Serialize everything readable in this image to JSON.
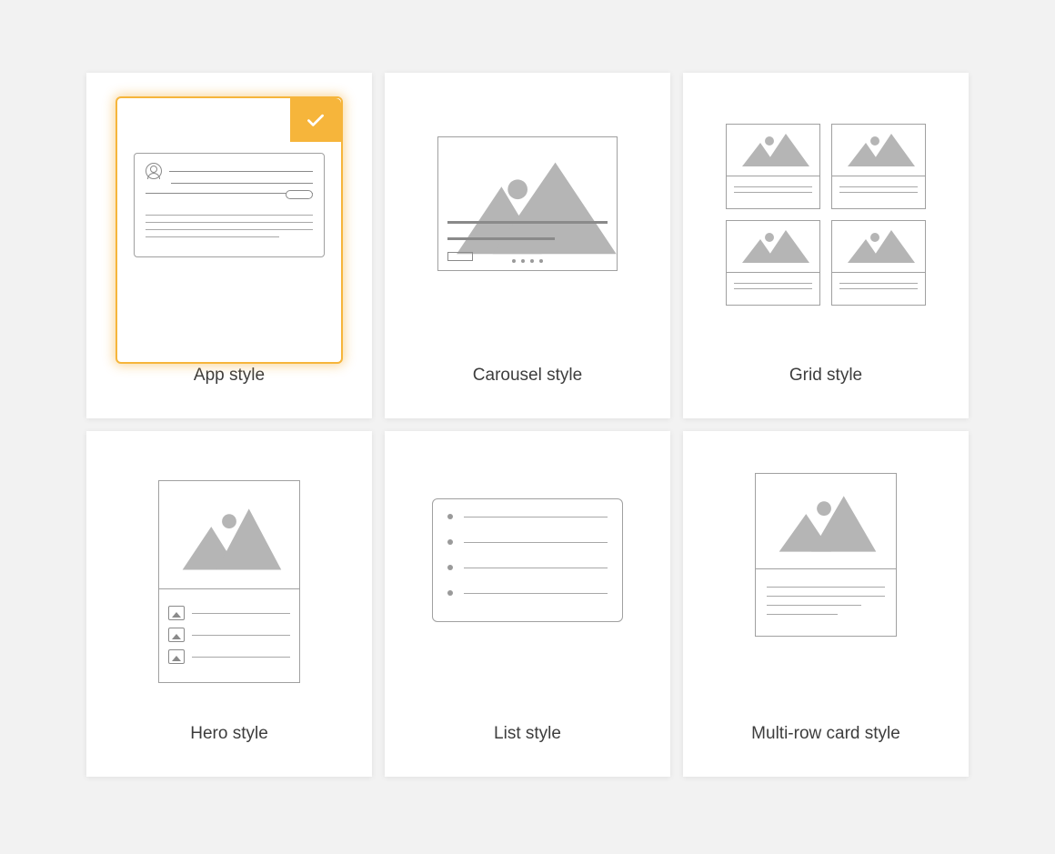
{
  "accent_color": "#F6B53B",
  "styles": {
    "app": {
      "label": "App style",
      "selected": true
    },
    "carousel": {
      "label": "Carousel style",
      "selected": false
    },
    "grid": {
      "label": "Grid style",
      "selected": false
    },
    "hero": {
      "label": "Hero style",
      "selected": false
    },
    "list": {
      "label": "List style",
      "selected": false
    },
    "multirow": {
      "label": "Multi-row card style",
      "selected": false
    }
  }
}
